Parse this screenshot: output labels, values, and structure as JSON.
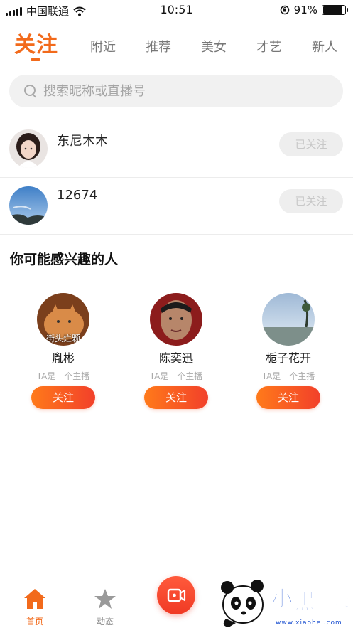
{
  "status_bar": {
    "carrier": "中国联通",
    "time": "10:51",
    "battery": "91%",
    "battery_level": 0.91
  },
  "tabs": [
    {
      "label": "关注",
      "active": true
    },
    {
      "label": "附近",
      "active": false
    },
    {
      "label": "推荐",
      "active": false
    },
    {
      "label": "美女",
      "active": false
    },
    {
      "label": "才艺",
      "active": false
    },
    {
      "label": "新人",
      "active": false
    }
  ],
  "search": {
    "placeholder": "搜索昵称或直播号"
  },
  "following": [
    {
      "name": "东尼木木",
      "button": "已关注"
    },
    {
      "name": "12674",
      "button": "已关注"
    }
  ],
  "suggestions": {
    "title": "你可能感兴趣的人",
    "people": [
      {
        "name": "胤彬",
        "desc": "TA是一个主播",
        "button": "关注",
        "avatar_caption": "街头烂颗"
      },
      {
        "name": "陈奕迅",
        "desc": "TA是一个主播",
        "button": "关注"
      },
      {
        "name": "栀子花开",
        "desc": "TA是一个主播",
        "button": "关注"
      }
    ]
  },
  "bottom_nav": {
    "home": {
      "label": "首页",
      "icon": "home-icon",
      "color": "#f26a1b"
    },
    "dynamics": {
      "label": "动态",
      "icon": "star-icon",
      "color": "#888888"
    },
    "live": {
      "icon": "video-camera-icon",
      "color": "#f2402a"
    }
  },
  "watermark": {
    "text": "小黑游戏",
    "url_text": "www.xiaohei.com"
  },
  "colors": {
    "accent": "#f26a1b",
    "follow_gradient_start": "#ff7a1a",
    "follow_gradient_end": "#f2402a"
  }
}
